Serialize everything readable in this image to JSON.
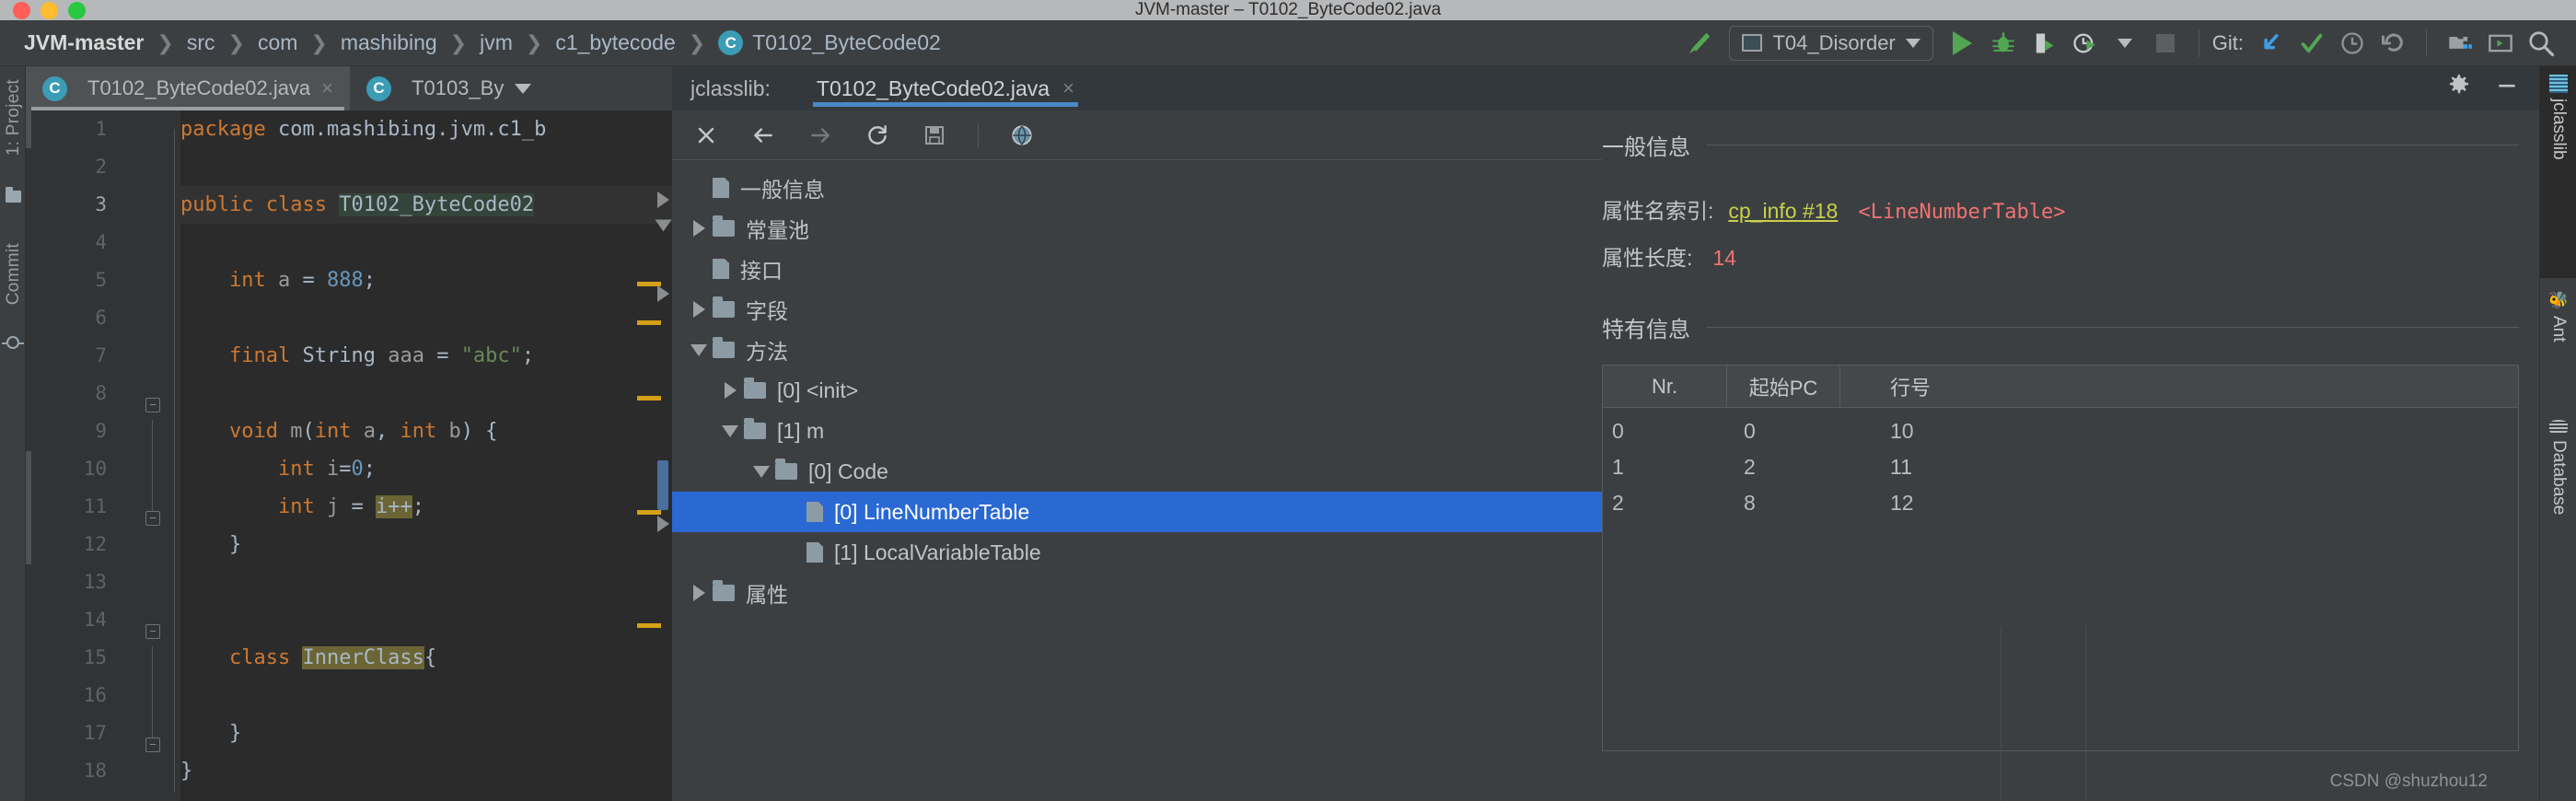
{
  "window": {
    "title": "JVM-master – T0102_ByteCode02.java",
    "traffic_lights": [
      "close-red",
      "minimize-yellow",
      "zoom-green"
    ]
  },
  "breadcrumb": {
    "items": [
      "JVM-master",
      "src",
      "com",
      "mashibing",
      "jvm",
      "c1_bytecode",
      "T0102_ByteCode02"
    ],
    "file_badge": "C"
  },
  "toolbar": {
    "build_icon": "hammer-icon",
    "run_config": {
      "label": "T04_Disorder",
      "icon": "run-config-icon",
      "caret": "chevron-down-icon"
    },
    "run_icon": "run-icon",
    "debug_icon": "debug-bug-icon",
    "coverage_icon": "run-with-coverage-icon",
    "profile_icon": "profiler-icon",
    "profile_caret": "chevron-down-icon",
    "stop_icon": "stop-icon",
    "git_label": "Git:",
    "git_update_icon": "update-project-icon",
    "git_commit_icon": "commit-checkmark-icon",
    "git_history_icon": "history-clock-icon",
    "git_rollback_icon": "rollback-icon",
    "layout_icon": "project-structure-icon",
    "terminal_icon": "terminal-icon",
    "search_icon": "search-icon"
  },
  "left_strip": [
    {
      "label": "1: Project",
      "icon": "folder-icon"
    },
    {
      "label": "Commit",
      "icon": "commit-icon"
    }
  ],
  "right_strip": [
    {
      "label": "jclasslib",
      "icon": "jclasslib-icon",
      "active": true
    },
    {
      "label": "Ant",
      "icon": "ant-icon",
      "active": false
    },
    {
      "label": "Database",
      "icon": "database-icon",
      "active": false
    }
  ],
  "editor_tabs": [
    {
      "label": "T0102_ByteCode02.java",
      "badge": "C",
      "selected": true,
      "close": "×"
    },
    {
      "label": "T0103_By",
      "badge": "C",
      "selected": false,
      "overflow": "chevron-down-icon"
    }
  ],
  "jclasslib_panel": {
    "title": "jclasslib:",
    "tab_label": "T0102_ByteCode02.java",
    "tab_close": "×",
    "settings_icon": "gear-icon",
    "minimize_icon": "minimize-icon",
    "toolbar_icons": [
      "close-icon",
      "back-arrow-icon",
      "forward-arrow-icon",
      "reload-icon",
      "save-icon",
      "browse-web-icon"
    ]
  },
  "editor": {
    "lines": [
      {
        "n": "1",
        "tokens": [
          [
            "kw",
            "package"
          ],
          [
            "pun",
            " com.mashibing.jvm.c1_b"
          ]
        ]
      },
      {
        "n": "2",
        "tokens": []
      },
      {
        "n": "3",
        "tokens": [
          [
            "kw",
            "public "
          ],
          [
            "kw",
            "class "
          ],
          [
            "hl-green",
            "T0102_ByteCode02"
          ],
          [
            "pun",
            " "
          ]
        ],
        "current": true
      },
      {
        "n": "4",
        "tokens": []
      },
      {
        "n": "5",
        "tokens": [
          [
            "pun",
            "    "
          ],
          [
            "kw",
            "int"
          ],
          [
            "id-grey",
            " a "
          ],
          [
            "pun",
            "= "
          ],
          [
            "num",
            "888"
          ],
          [
            "pun",
            ";"
          ]
        ]
      },
      {
        "n": "6",
        "tokens": []
      },
      {
        "n": "7",
        "tokens": [
          [
            "pun",
            "    "
          ],
          [
            "kw",
            "final "
          ],
          [
            "pun",
            "String"
          ],
          [
            "id-grey",
            " aaa "
          ],
          [
            "pun",
            "= "
          ],
          [
            "str",
            "\"abc\""
          ],
          [
            "pun",
            ";"
          ]
        ]
      },
      {
        "n": "8",
        "tokens": []
      },
      {
        "n": "9",
        "tokens": [
          [
            "pun",
            "    "
          ],
          [
            "kw",
            "void "
          ],
          [
            "id-grey",
            "m"
          ],
          [
            "pun",
            "("
          ],
          [
            "kw",
            "int"
          ],
          [
            "id-grey",
            " a"
          ],
          [
            "pun",
            ", "
          ],
          [
            "kw",
            "int"
          ],
          [
            "id-grey",
            " b"
          ],
          [
            "pun",
            ") {"
          ]
        ]
      },
      {
        "n": "10",
        "tokens": [
          [
            "pun",
            "        "
          ],
          [
            "kw",
            "int "
          ],
          [
            "id-grey",
            "i"
          ],
          [
            "pun",
            "="
          ],
          [
            "num",
            "0"
          ],
          [
            "pun",
            ";"
          ]
        ]
      },
      {
        "n": "11",
        "tokens": [
          [
            "pun",
            "        "
          ],
          [
            "kw",
            "int "
          ],
          [
            "id-grey",
            "j "
          ],
          [
            "pun",
            "= "
          ],
          [
            "hl-olive",
            "i++"
          ],
          [
            "pun",
            ";"
          ]
        ]
      },
      {
        "n": "12",
        "tokens": [
          [
            "pun",
            "    }"
          ]
        ]
      },
      {
        "n": "13",
        "tokens": []
      },
      {
        "n": "14",
        "tokens": []
      },
      {
        "n": "15",
        "tokens": [
          [
            "pun",
            "    "
          ],
          [
            "kw",
            "class "
          ],
          [
            "hl-olive",
            "InnerClass"
          ],
          [
            "pun",
            "{"
          ]
        ]
      },
      {
        "n": "16",
        "tokens": []
      },
      {
        "n": "17",
        "tokens": [
          [
            "pun",
            "    }"
          ]
        ]
      },
      {
        "n": "18",
        "tokens": [
          [
            "pun",
            "}"
          ]
        ]
      }
    ]
  },
  "tree": [
    {
      "label": "一般信息",
      "indent": 0,
      "arrow": "none",
      "icon": "leaf"
    },
    {
      "label": "常量池",
      "indent": 0,
      "arrow": "collapsed",
      "icon": "folder"
    },
    {
      "label": "接口",
      "indent": 0,
      "arrow": "none",
      "icon": "leaf"
    },
    {
      "label": "字段",
      "indent": 0,
      "arrow": "collapsed",
      "icon": "folder"
    },
    {
      "label": "方法",
      "indent": 0,
      "arrow": "expanded",
      "icon": "folder"
    },
    {
      "label": "[0] <init>",
      "indent": 1,
      "arrow": "collapsed",
      "icon": "folder"
    },
    {
      "label": "[1] m",
      "indent": 1,
      "arrow": "expanded",
      "icon": "folder"
    },
    {
      "label": "[0] Code",
      "indent": 2,
      "arrow": "expanded",
      "icon": "folder"
    },
    {
      "label": "[0] LineNumberTable",
      "indent": 3,
      "arrow": "none",
      "icon": "leaf",
      "selected": true
    },
    {
      "label": "[1] LocalVariableTable",
      "indent": 3,
      "arrow": "none",
      "icon": "leaf"
    },
    {
      "label": "属性",
      "indent": 0,
      "arrow": "collapsed",
      "icon": "folder"
    }
  ],
  "detail": {
    "general_title": "一般信息",
    "attr_name_key": "属性名索引:",
    "attr_name_link": "cp_info #18",
    "attr_name_value": "<LineNumberTable>",
    "attr_len_key": "属性长度:",
    "attr_len_value": "14",
    "specific_title": "特有信息",
    "table": {
      "columns": [
        "Nr.",
        "起始PC",
        "行号"
      ],
      "rows": [
        [
          "0",
          "0",
          "10"
        ],
        [
          "1",
          "2",
          "11"
        ],
        [
          "2",
          "8",
          "12"
        ]
      ]
    }
  },
  "watermark": "CSDN @shuzhou12"
}
